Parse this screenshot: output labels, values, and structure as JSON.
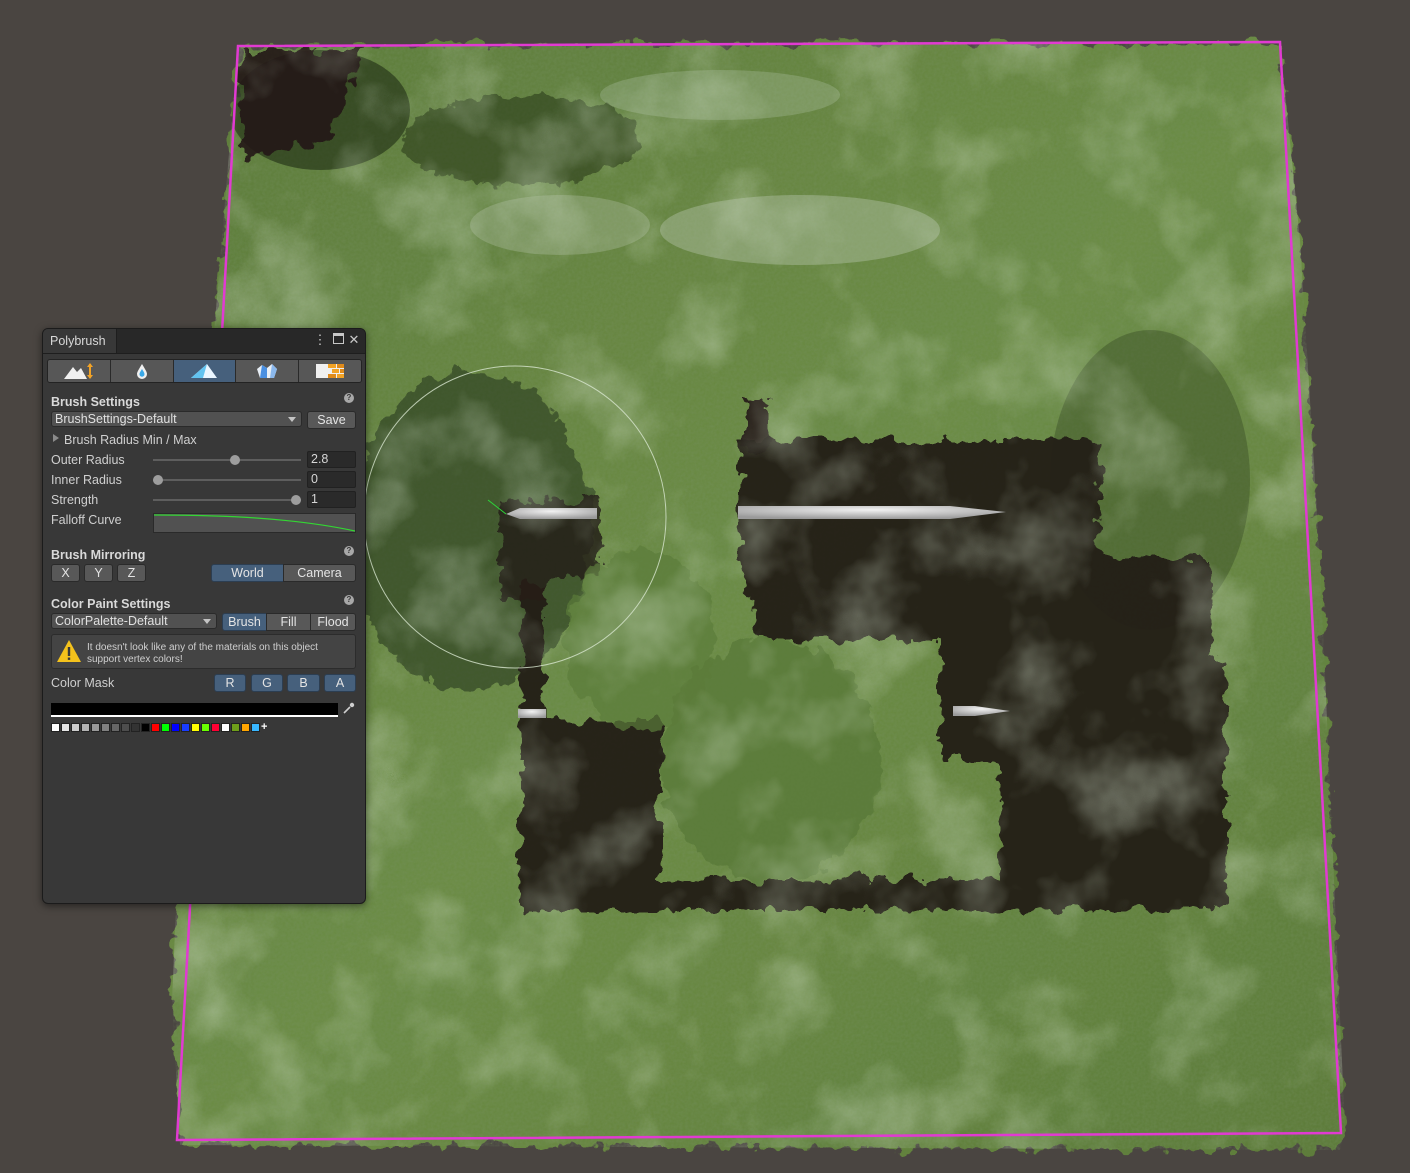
{
  "scene": {
    "colors": {
      "background": "#4a4541",
      "selection_outline": "#e13ad2",
      "grass_light": "#6f8f48",
      "grass_dark": "#2f4222",
      "pit": "#211a15"
    }
  },
  "panel": {
    "title": "Polybrush",
    "tools": [
      {
        "name": "sculpt-tool",
        "active": false
      },
      {
        "name": "smooth-tool",
        "active": false
      },
      {
        "name": "paint-vertex-colors-tool",
        "active": true
      },
      {
        "name": "scatter-prefab-tool",
        "active": false
      },
      {
        "name": "paint-texture-tool",
        "active": false
      }
    ],
    "brush_settings": {
      "title": "Brush Settings",
      "preset": "BrushSettings-Default",
      "save_label": "Save",
      "radius_foldout": "Brush Radius Min / Max",
      "outer_radius_label": "Outer Radius",
      "outer_radius_value": "2.8",
      "outer_radius_fraction": 0.56,
      "inner_radius_label": "Inner Radius",
      "inner_radius_value": "0",
      "inner_radius_fraction": 0.0,
      "strength_label": "Strength",
      "strength_value": "1",
      "strength_fraction": 1.0,
      "falloff_label": "Falloff Curve"
    },
    "mirroring": {
      "title": "Brush Mirroring",
      "x": "X",
      "y": "Y",
      "z": "Z",
      "world": "World",
      "camera": "Camera",
      "space_selected": "World"
    },
    "color_paint": {
      "title": "Color Paint Settings",
      "palette": "ColorPalette-Default",
      "brush": "Brush",
      "fill": "Fill",
      "flood": "Flood",
      "mode_selected": "Brush",
      "warning": "It doesn't look like any of the materials on this object support vertex colors!",
      "mask_label": "Color Mask",
      "r": "R",
      "g": "G",
      "b": "B",
      "a": "A",
      "current_color": "#000000",
      "swatches": [
        "#ffffff",
        "#e6e6e6",
        "#cccccc",
        "#b3b3b3",
        "#999999",
        "#808080",
        "#666666",
        "#4d4d4d",
        "#333333",
        "#000000",
        "#ff0000",
        "#00ff00",
        "#0000ff",
        "#1a3cff",
        "#ffff00",
        "#6aff00",
        "#ff0033",
        "#ffffff",
        "#6f9e1a",
        "#ffa500",
        "#38b6ff"
      ]
    }
  }
}
